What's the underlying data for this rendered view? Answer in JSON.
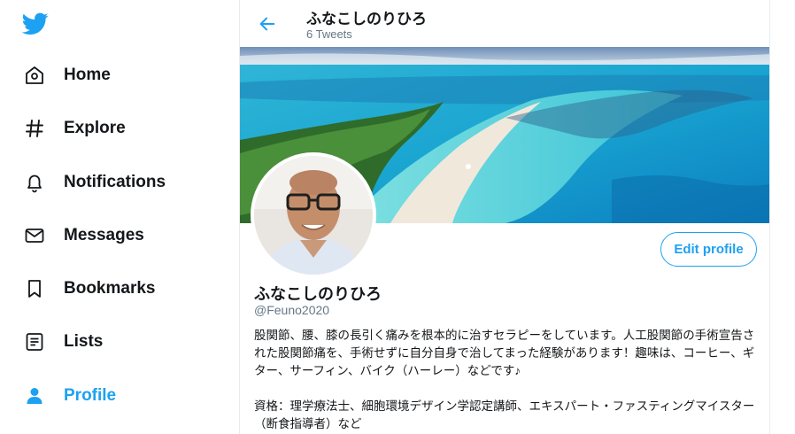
{
  "sidebar": {
    "items": [
      {
        "label": "Home",
        "icon": "home-icon"
      },
      {
        "label": "Explore",
        "icon": "hashtag-icon"
      },
      {
        "label": "Notifications",
        "icon": "bell-icon"
      },
      {
        "label": "Messages",
        "icon": "envelope-icon"
      },
      {
        "label": "Bookmarks",
        "icon": "bookmark-icon"
      },
      {
        "label": "Lists",
        "icon": "list-icon"
      },
      {
        "label": "Profile",
        "icon": "person-icon",
        "active": true
      }
    ]
  },
  "header": {
    "title": "ふなこしのりひろ",
    "subtitle": "6 Tweets"
  },
  "profile": {
    "name": "ふなこしのりひろ",
    "handle": "@Feuno2020",
    "edit_label": "Edit profile",
    "bio": "股関節、腰、膝の長引く痛みを根本的に治すセラピーをしています。人工股関節の手術宣告された股関節痛を、手術せずに自分自身で治してまった経験があります！趣味は、コーヒー、ギター、サーフィン、バイク（ハーレー）などです♪\n\n資格：理学療法士、細胞環境デザイン学認定講師、エキスパート・ファスティングマイスター（断食指導者）など"
  },
  "colors": {
    "accent": "#1da1f2",
    "text": "#14171a",
    "secondary": "#657786"
  }
}
